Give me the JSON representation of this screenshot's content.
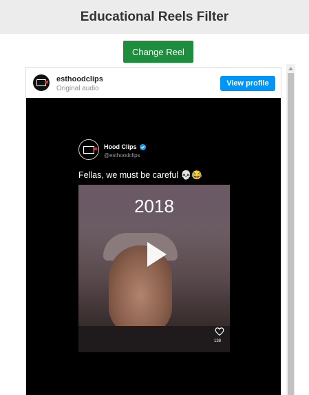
{
  "page": {
    "title": "Educational Reels Filter",
    "change_button_label": "Change Reel"
  },
  "embed": {
    "username": "esthoodclips",
    "subtitle": "Original audio",
    "view_profile_label": "View profile",
    "avatar_icon": "hood-clips-logo"
  },
  "video": {
    "tweet_name": "Hood Clips",
    "tweet_handle": "@esthoodclips",
    "tweet_text": "Fellas, we must be careful 💀😂",
    "clip_year": "2018",
    "like_count": "138",
    "play_icon": "play-icon",
    "heart_icon": "heart-icon"
  },
  "colors": {
    "header_bg": "#ececec",
    "change_button": "#1e8e3e",
    "view_profile_button": "#0095f6",
    "video_bg": "#000000"
  }
}
